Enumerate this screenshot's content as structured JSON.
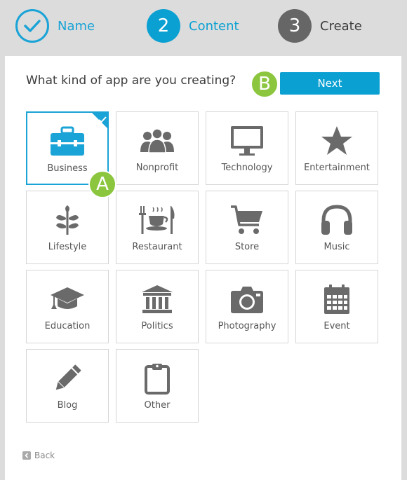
{
  "steps": [
    {
      "number": "",
      "label": "Name",
      "state": "done"
    },
    {
      "number": "2",
      "label": "Content",
      "state": "active"
    },
    {
      "number": "3",
      "label": "Create",
      "state": "pending"
    }
  ],
  "question": "What kind of app are you creating?",
  "next_label": "Next",
  "badges": {
    "a": "A",
    "b": "B"
  },
  "categories": [
    {
      "label": "Business",
      "icon": "briefcase-icon",
      "selected": true
    },
    {
      "label": "Nonprofit",
      "icon": "people-icon"
    },
    {
      "label": "Technology",
      "icon": "monitor-icon"
    },
    {
      "label": "Entertainment",
      "icon": "star-icon"
    },
    {
      "label": "Lifestyle",
      "icon": "plant-icon"
    },
    {
      "label": "Restaurant",
      "icon": "dining-icon"
    },
    {
      "label": "Store",
      "icon": "cart-icon"
    },
    {
      "label": "Music",
      "icon": "headphones-icon"
    },
    {
      "label": "Education",
      "icon": "graduation-cap-icon"
    },
    {
      "label": "Politics",
      "icon": "building-icon"
    },
    {
      "label": "Photography",
      "icon": "camera-icon"
    },
    {
      "label": "Event",
      "icon": "calendar-icon"
    },
    {
      "label": "Blog",
      "icon": "pencil-icon"
    },
    {
      "label": "Other",
      "icon": "clipboard-icon"
    }
  ],
  "back_label": "Back",
  "colors": {
    "accent": "#0aa0d2",
    "badge": "#8cc63f",
    "icon_gray": "#6a6a6a"
  }
}
